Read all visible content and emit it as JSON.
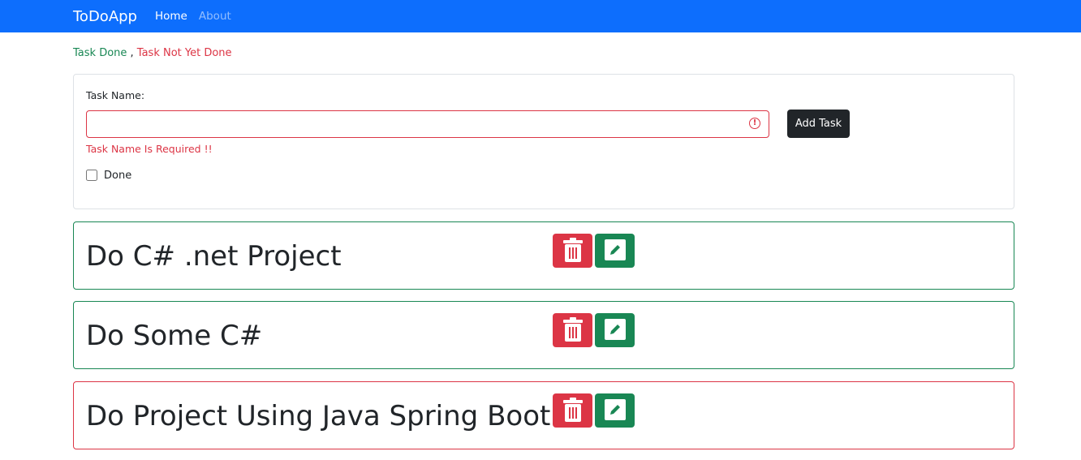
{
  "navbar": {
    "brand": "ToDoApp",
    "links": [
      "Home",
      "About"
    ]
  },
  "legend": {
    "done": "Task Done",
    "separator": " , ",
    "not_done": "Task Not Yet Done"
  },
  "form": {
    "label": "Task Name:",
    "value": "",
    "error": "Task Name Is Required !!",
    "checkbox_label": "Done",
    "add_button": "Add Task"
  },
  "tasks": [
    {
      "title": "Do C# .net Project",
      "done": true
    },
    {
      "title": "Do Some C#",
      "done": true
    },
    {
      "title": "Do Project Using Java Spring Boot",
      "done": false
    }
  ],
  "colors": {
    "primary": "#0d6efd",
    "success": "#198754",
    "danger": "#dc3545",
    "dark": "#212529"
  }
}
